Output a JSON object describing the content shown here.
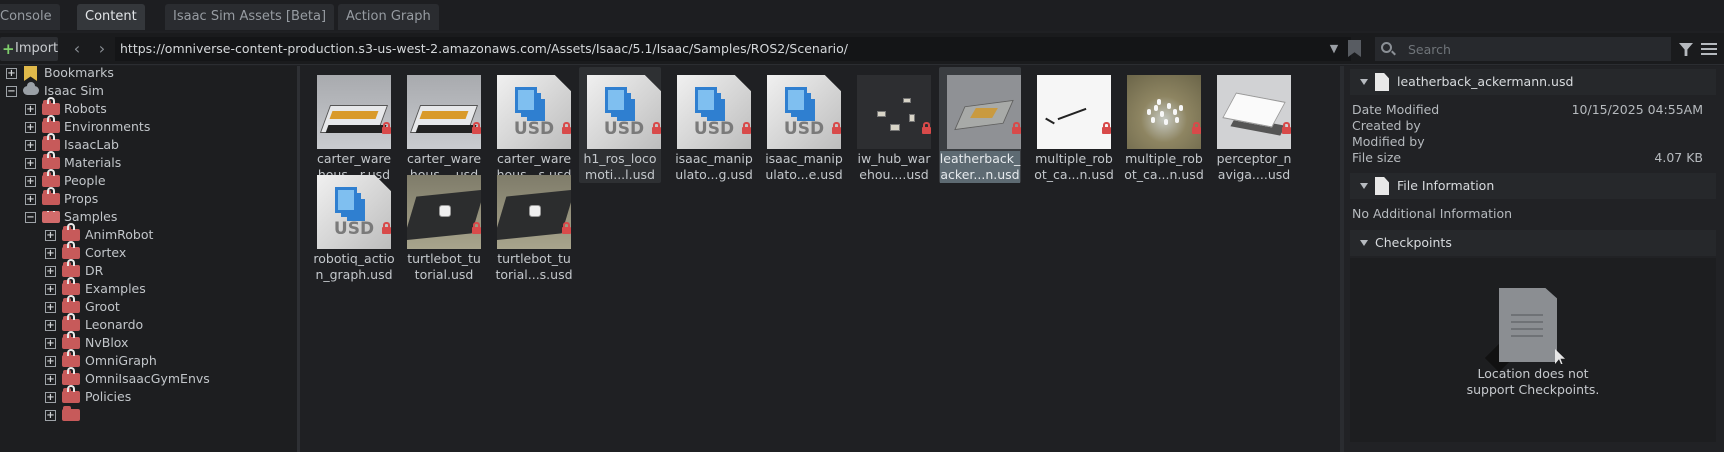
{
  "tabs": [
    {
      "label": "Console"
    },
    {
      "label": "Content"
    },
    {
      "label": "Isaac Sim Assets [Beta]"
    },
    {
      "label": "Action Graph"
    }
  ],
  "toolbar": {
    "import_label": "Import",
    "url": "https://omniverse-content-production.s3-us-west-2.amazonaws.com/Assets/Isaac/5.1/Isaac/Samples/ROS2/Scenario/",
    "search_placeholder": "Search"
  },
  "tree": {
    "items": [
      {
        "label": "Bookmarks"
      },
      {
        "label": "Isaac Sim"
      },
      {
        "label": "Robots"
      },
      {
        "label": "Environments"
      },
      {
        "label": "IsaacLab"
      },
      {
        "label": "Materials"
      },
      {
        "label": "People"
      },
      {
        "label": "Props"
      },
      {
        "label": "Samples"
      },
      {
        "label": "AnimRobot"
      },
      {
        "label": "Cortex"
      },
      {
        "label": "DR"
      },
      {
        "label": "Examples"
      },
      {
        "label": "Groot"
      },
      {
        "label": "Leonardo"
      },
      {
        "label": "NvBlox"
      },
      {
        "label": "OmniGraph"
      },
      {
        "label": "OmniIsaacGymEnvs"
      },
      {
        "label": "Policies"
      }
    ]
  },
  "files": [
    {
      "line1": "carter_ware",
      "line2": "hous...r.usd",
      "thumb": "warehouse"
    },
    {
      "line1": "carter_ware",
      "line2": "hous....usd",
      "thumb": "warehouse"
    },
    {
      "line1": "carter_ware",
      "line2": "hous...s.usd",
      "thumb": "usd"
    },
    {
      "line1": "h1_ros_loco",
      "line2": "moti...l.usd",
      "thumb": "usd"
    },
    {
      "line1": "isaac_manip",
      "line2": "ulato...g.usd",
      "thumb": "usd"
    },
    {
      "line1": "isaac_manip",
      "line2": "ulato...e.usd",
      "thumb": "usd"
    },
    {
      "line1": "iw_hub_war",
      "line2": "ehou....usd",
      "thumb": "dark"
    },
    {
      "line1": "leatherback_",
      "line2": "acker...n.usd",
      "thumb": "grey"
    },
    {
      "line1": "multiple_rob",
      "line2": "ot_ca...n.usd",
      "thumb": "white"
    },
    {
      "line1": "multiple_rob",
      "line2": "ot_ca...n.usd",
      "thumb": "flowers"
    },
    {
      "line1": "perceptor_n",
      "line2": "aviga....usd",
      "thumb": "perceptor"
    },
    {
      "line1": "robotiq_actio",
      "line2": "n_graph.usd",
      "thumb": "usd"
    },
    {
      "line1": "turtlebot_tu",
      "line2": "torial.usd",
      "thumb": "turtle"
    },
    {
      "line1": "turtlebot_tu",
      "line2": "torial...s.usd",
      "thumb": "turtle"
    }
  ],
  "usd_badge": "USD",
  "info": {
    "filename": "leatherback_ackermann.usd",
    "date_modified_label": "Date Modified",
    "date_modified_value": "10/15/2025 04:55AM",
    "created_by_label": "Created by",
    "modified_by_label": "Modified by",
    "file_size_label": "File size",
    "file_size_value": "4.07 KB",
    "file_info_title": "File Information",
    "file_info_text": "No Additional Information",
    "checkpoints_title": "Checkpoints",
    "checkpoints_msg_line1": "Location does not",
    "checkpoints_msg_line2": "support Checkpoints."
  }
}
